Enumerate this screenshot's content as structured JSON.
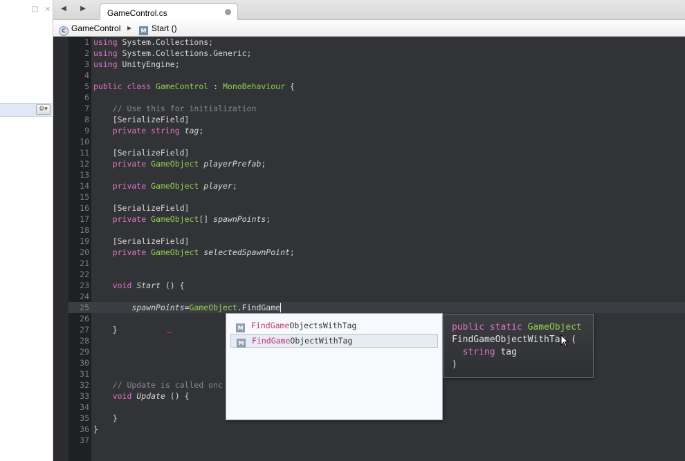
{
  "left_panel": {
    "window_buttons": "□ ×",
    "gear_button": "⚙▾"
  },
  "tabbar": {
    "back_arrow": "◀",
    "forward_arrow": "▶",
    "active_tab": "GameControl.cs"
  },
  "breadcrumb": {
    "class_icon": "C",
    "class_name": "GameControl",
    "separator": "▶",
    "method_icon": "M",
    "method_name": "Start ()"
  },
  "code_lines": [
    {
      "n": "1",
      "tokens": [
        {
          "t": "using",
          "c": "kw"
        },
        {
          "t": " System.Collections;",
          "c": ""
        }
      ]
    },
    {
      "n": "2",
      "tokens": [
        {
          "t": "using",
          "c": "kw"
        },
        {
          "t": " System.Collections.Generic;",
          "c": ""
        }
      ]
    },
    {
      "n": "3",
      "tokens": [
        {
          "t": "using",
          "c": "kw"
        },
        {
          "t": " UnityEngine;",
          "c": ""
        }
      ]
    },
    {
      "n": "4",
      "tokens": []
    },
    {
      "n": "5",
      "tokens": [
        {
          "t": "public class",
          "c": "kw"
        },
        {
          "t": " ",
          "c": ""
        },
        {
          "t": "GameControl",
          "c": "ty"
        },
        {
          "t": " : ",
          "c": ""
        },
        {
          "t": "MonoBehaviour",
          "c": "ty"
        },
        {
          "t": " {",
          "c": ""
        }
      ]
    },
    {
      "n": "6",
      "tokens": []
    },
    {
      "n": "7",
      "tokens": [
        {
          "t": "    // Use this for initialization",
          "c": "cm"
        }
      ]
    },
    {
      "n": "8",
      "tokens": [
        {
          "t": "    [SerializeField]",
          "c": ""
        }
      ]
    },
    {
      "n": "9",
      "tokens": [
        {
          "t": "    private string",
          "c": "kw"
        },
        {
          "t": " ",
          "c": ""
        },
        {
          "t": "tag",
          "c": "it"
        },
        {
          "t": ";",
          "c": ""
        }
      ]
    },
    {
      "n": "10",
      "tokens": []
    },
    {
      "n": "11",
      "tokens": [
        {
          "t": "    [SerializeField]",
          "c": ""
        }
      ]
    },
    {
      "n": "12",
      "tokens": [
        {
          "t": "    private",
          "c": "kw"
        },
        {
          "t": " ",
          "c": ""
        },
        {
          "t": "GameObject",
          "c": "ty"
        },
        {
          "t": " ",
          "c": ""
        },
        {
          "t": "playerPrefab",
          "c": "it"
        },
        {
          "t": ";",
          "c": ""
        }
      ]
    },
    {
      "n": "13",
      "tokens": []
    },
    {
      "n": "14",
      "tokens": [
        {
          "t": "    private",
          "c": "kw"
        },
        {
          "t": " ",
          "c": ""
        },
        {
          "t": "GameObject",
          "c": "ty"
        },
        {
          "t": " ",
          "c": ""
        },
        {
          "t": "player",
          "c": "it"
        },
        {
          "t": ";",
          "c": ""
        }
      ]
    },
    {
      "n": "15",
      "tokens": []
    },
    {
      "n": "16",
      "tokens": [
        {
          "t": "    [SerializeField]",
          "c": ""
        }
      ]
    },
    {
      "n": "17",
      "tokens": [
        {
          "t": "    private",
          "c": "kw"
        },
        {
          "t": " ",
          "c": ""
        },
        {
          "t": "GameObject",
          "c": "ty"
        },
        {
          "t": "[] ",
          "c": ""
        },
        {
          "t": "spawnPoints",
          "c": "it"
        },
        {
          "t": ";",
          "c": ""
        }
      ]
    },
    {
      "n": "18",
      "tokens": []
    },
    {
      "n": "19",
      "tokens": [
        {
          "t": "    [SerializeField]",
          "c": ""
        }
      ]
    },
    {
      "n": "20",
      "tokens": [
        {
          "t": "    private",
          "c": "kw"
        },
        {
          "t": " ",
          "c": ""
        },
        {
          "t": "GameObject",
          "c": "ty"
        },
        {
          "t": " ",
          "c": ""
        },
        {
          "t": "selectedSpawnPoint",
          "c": "it"
        },
        {
          "t": ";",
          "c": ""
        }
      ]
    },
    {
      "n": "21",
      "tokens": []
    },
    {
      "n": "22",
      "tokens": []
    },
    {
      "n": "23",
      "tokens": [
        {
          "t": "    void",
          "c": "kw"
        },
        {
          "t": " ",
          "c": ""
        },
        {
          "t": "Start",
          "c": "it"
        },
        {
          "t": " () {",
          "c": ""
        }
      ]
    },
    {
      "n": "24",
      "tokens": []
    },
    {
      "n": "25",
      "tokens": [
        {
          "t": "        ",
          "c": ""
        },
        {
          "t": "spawnPoints",
          "c": "it"
        },
        {
          "t": "=",
          "c": ""
        },
        {
          "t": "GameObject",
          "c": "ty"
        },
        {
          "t": ".FindGame",
          "c": ""
        }
      ],
      "caret": true
    },
    {
      "n": "26",
      "tokens": []
    },
    {
      "n": "27",
      "tokens": [
        {
          "t": "    }",
          "c": ""
        }
      ]
    },
    {
      "n": "28",
      "tokens": []
    },
    {
      "n": "29",
      "tokens": []
    },
    {
      "n": "30",
      "tokens": []
    },
    {
      "n": "31",
      "tokens": []
    },
    {
      "n": "32",
      "tokens": [
        {
          "t": "    // Update is called onc",
          "c": "cm"
        }
      ]
    },
    {
      "n": "33",
      "tokens": [
        {
          "t": "    void",
          "c": "kw"
        },
        {
          "t": " ",
          "c": ""
        },
        {
          "t": "Update",
          "c": "it"
        },
        {
          "t": " () {",
          "c": ""
        }
      ]
    },
    {
      "n": "34",
      "tokens": []
    },
    {
      "n": "35",
      "tokens": [
        {
          "t": "    }",
          "c": ""
        }
      ]
    },
    {
      "n": "36",
      "tokens": [
        {
          "t": "}",
          "c": ""
        }
      ]
    },
    {
      "n": "37",
      "tokens": []
    }
  ],
  "completion": {
    "items": [
      {
        "icon": "M",
        "match": "FindGame",
        "rest": "ObjectsWithTag",
        "selected": false
      },
      {
        "icon": "M",
        "match": "FindGame",
        "rest": "ObjectWithTag",
        "selected": true
      }
    ]
  },
  "tooltip": {
    "kw": "public static",
    "return_type": "GameObject",
    "method": "FindGameObjectWithTag (",
    "param_type": "string",
    "param_name": "tag",
    "close": ")"
  },
  "colors": {
    "editor_bg": "#323337",
    "keyword": "#e074c6",
    "type": "#8fd150",
    "comment": "#8a8a8a",
    "match_highlight": "#c0357a"
  }
}
